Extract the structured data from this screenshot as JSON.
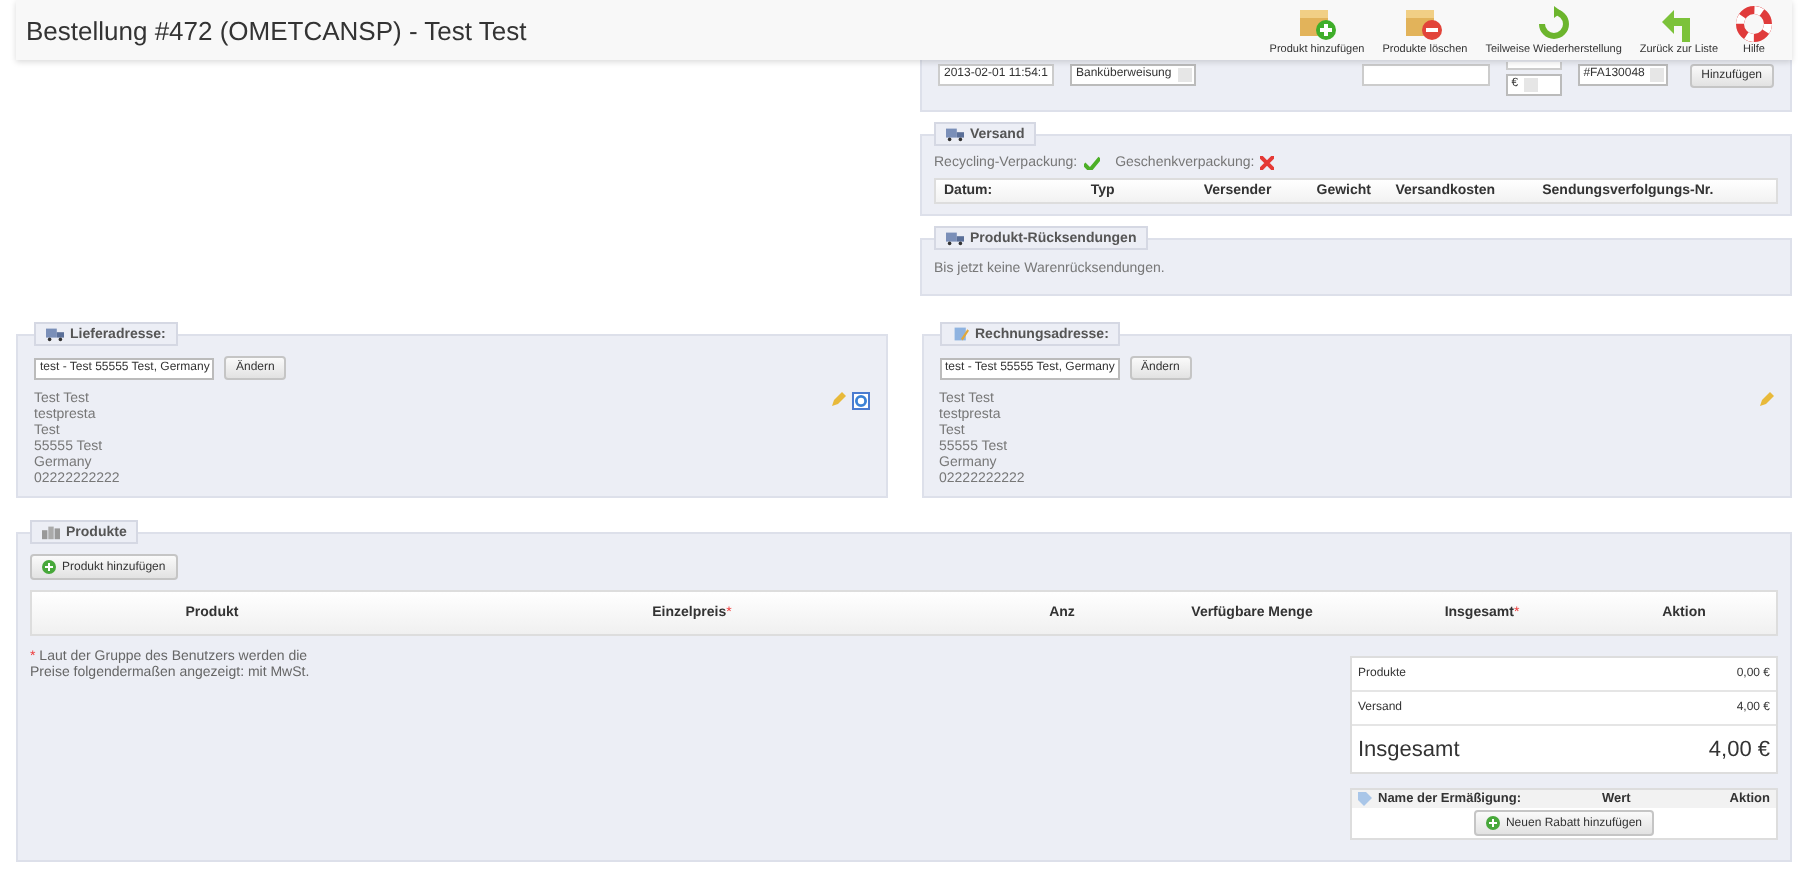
{
  "header": {
    "title": "Bestellung #472 (OMETCANSP) - Test Test",
    "toolbar": [
      {
        "kind": "add",
        "label": "Produkt hinzufügen"
      },
      {
        "kind": "remove",
        "label": "Produkte löschen"
      },
      {
        "kind": "restore",
        "label": "Teilweise Wiederherstellung"
      },
      {
        "kind": "back",
        "label": "Zurück zur Liste"
      },
      {
        "kind": "help",
        "label": "Hilfe"
      }
    ]
  },
  "payment": {
    "date": "2013-02-01 11:54:1",
    "method": "Banküberweisung",
    "currency": "€",
    "invoice": "#FA130048",
    "button": "Hinzufügen"
  },
  "shipping": {
    "title": "Versand",
    "options": [
      {
        "label": "Recycling-Verpackung:",
        "on": true
      },
      {
        "label": "Geschenkverpackung:",
        "on": false
      }
    ],
    "columns": [
      "Datum:",
      "Typ",
      "Versender",
      "Gewicht",
      "Versandkosten",
      "Sendungsverfolgungs-Nr."
    ]
  },
  "returns": {
    "title": "Produkt-Rücksendungen",
    "text": "Bis jetzt keine Warenrücksendungen."
  },
  "addresses": [
    {
      "kind": "delivery",
      "title": "Lieferadresse:",
      "select": "test - Test 55555 Test, Germany",
      "button": "Ändern",
      "lines": [
        "Test Test",
        "testpresta",
        "Test",
        "55555 Test",
        "Germany",
        "02222222222"
      ],
      "map": true
    },
    {
      "kind": "invoice",
      "title": "Rechnungsadresse:",
      "select": "test - Test 55555 Test, Germany",
      "button": "Ändern",
      "lines": [
        "Test Test",
        "testpresta",
        "Test",
        "55555 Test",
        "Germany",
        "02222222222"
      ],
      "map": false
    }
  ],
  "products": {
    "title": "Produkte",
    "add_button": "Produkt hinzufügen",
    "columns": [
      {
        "label": "Produkt"
      },
      {
        "label": "Einzelpreis",
        "mark": "*"
      },
      {
        "label": "Anz"
      },
      {
        "label": "Verfügbare Menge"
      },
      {
        "label": "Insgesamt",
        "mark": "*"
      },
      {
        "label": "Aktion"
      }
    ],
    "note_mark": "*",
    "note": "Laut der Gruppe des Benutzers werden die Preise folgendermaßen angezeigt: mit MwSt.",
    "summary": [
      {
        "label": "Produkte",
        "value": "0,00 €",
        "kind": "line"
      },
      {
        "label": "Versand",
        "value": "4,00 €",
        "kind": "line"
      },
      {
        "label": "Insgesamt",
        "value": "4,00 €",
        "kind": "total"
      }
    ],
    "discounts": {
      "columns": [
        "Name der Ermäßigung:",
        "Wert",
        "Aktion"
      ],
      "button": "Neuen Rabatt hinzufügen"
    }
  }
}
